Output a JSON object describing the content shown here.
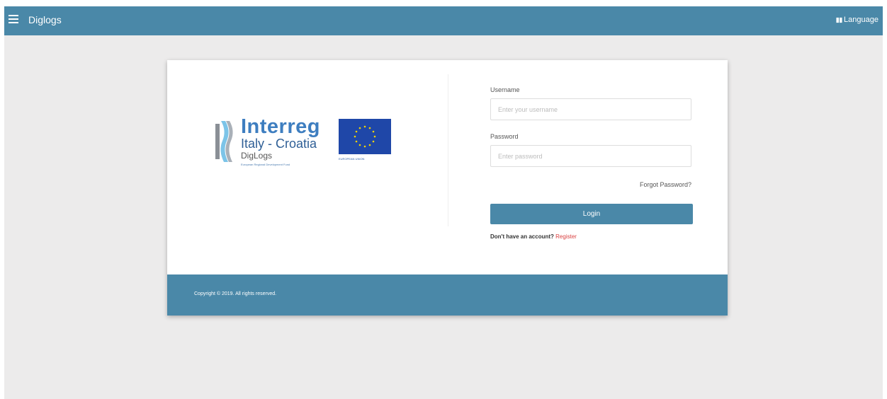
{
  "header": {
    "app_title": "Diglogs",
    "language_label": "Language"
  },
  "logo": {
    "program": "Interreg",
    "region": "Italy - Croatia",
    "project": "DigLogs",
    "fund": "European Regional Development Fund",
    "eu_label": "EUROPEAN UNION"
  },
  "login_form": {
    "username_label": "Username",
    "username_placeholder": "Enter your username",
    "username_value": "",
    "password_label": "Password",
    "password_placeholder": "Enter password",
    "password_value": "",
    "forgot_password": "Forgot Password?",
    "login_button": "Login",
    "no_account_text": "Don't have an account?",
    "register_link": "Register"
  },
  "footer": {
    "copyright": "Copyright © 2019. All rights reserved."
  },
  "colors": {
    "primary": "#4a88a8",
    "page_background": "#ecebeb",
    "register_link": "#d94040",
    "eu_blue": "#1f47a8",
    "eu_star": "#f2d300",
    "interreg_blue": "#3e7ec0"
  }
}
